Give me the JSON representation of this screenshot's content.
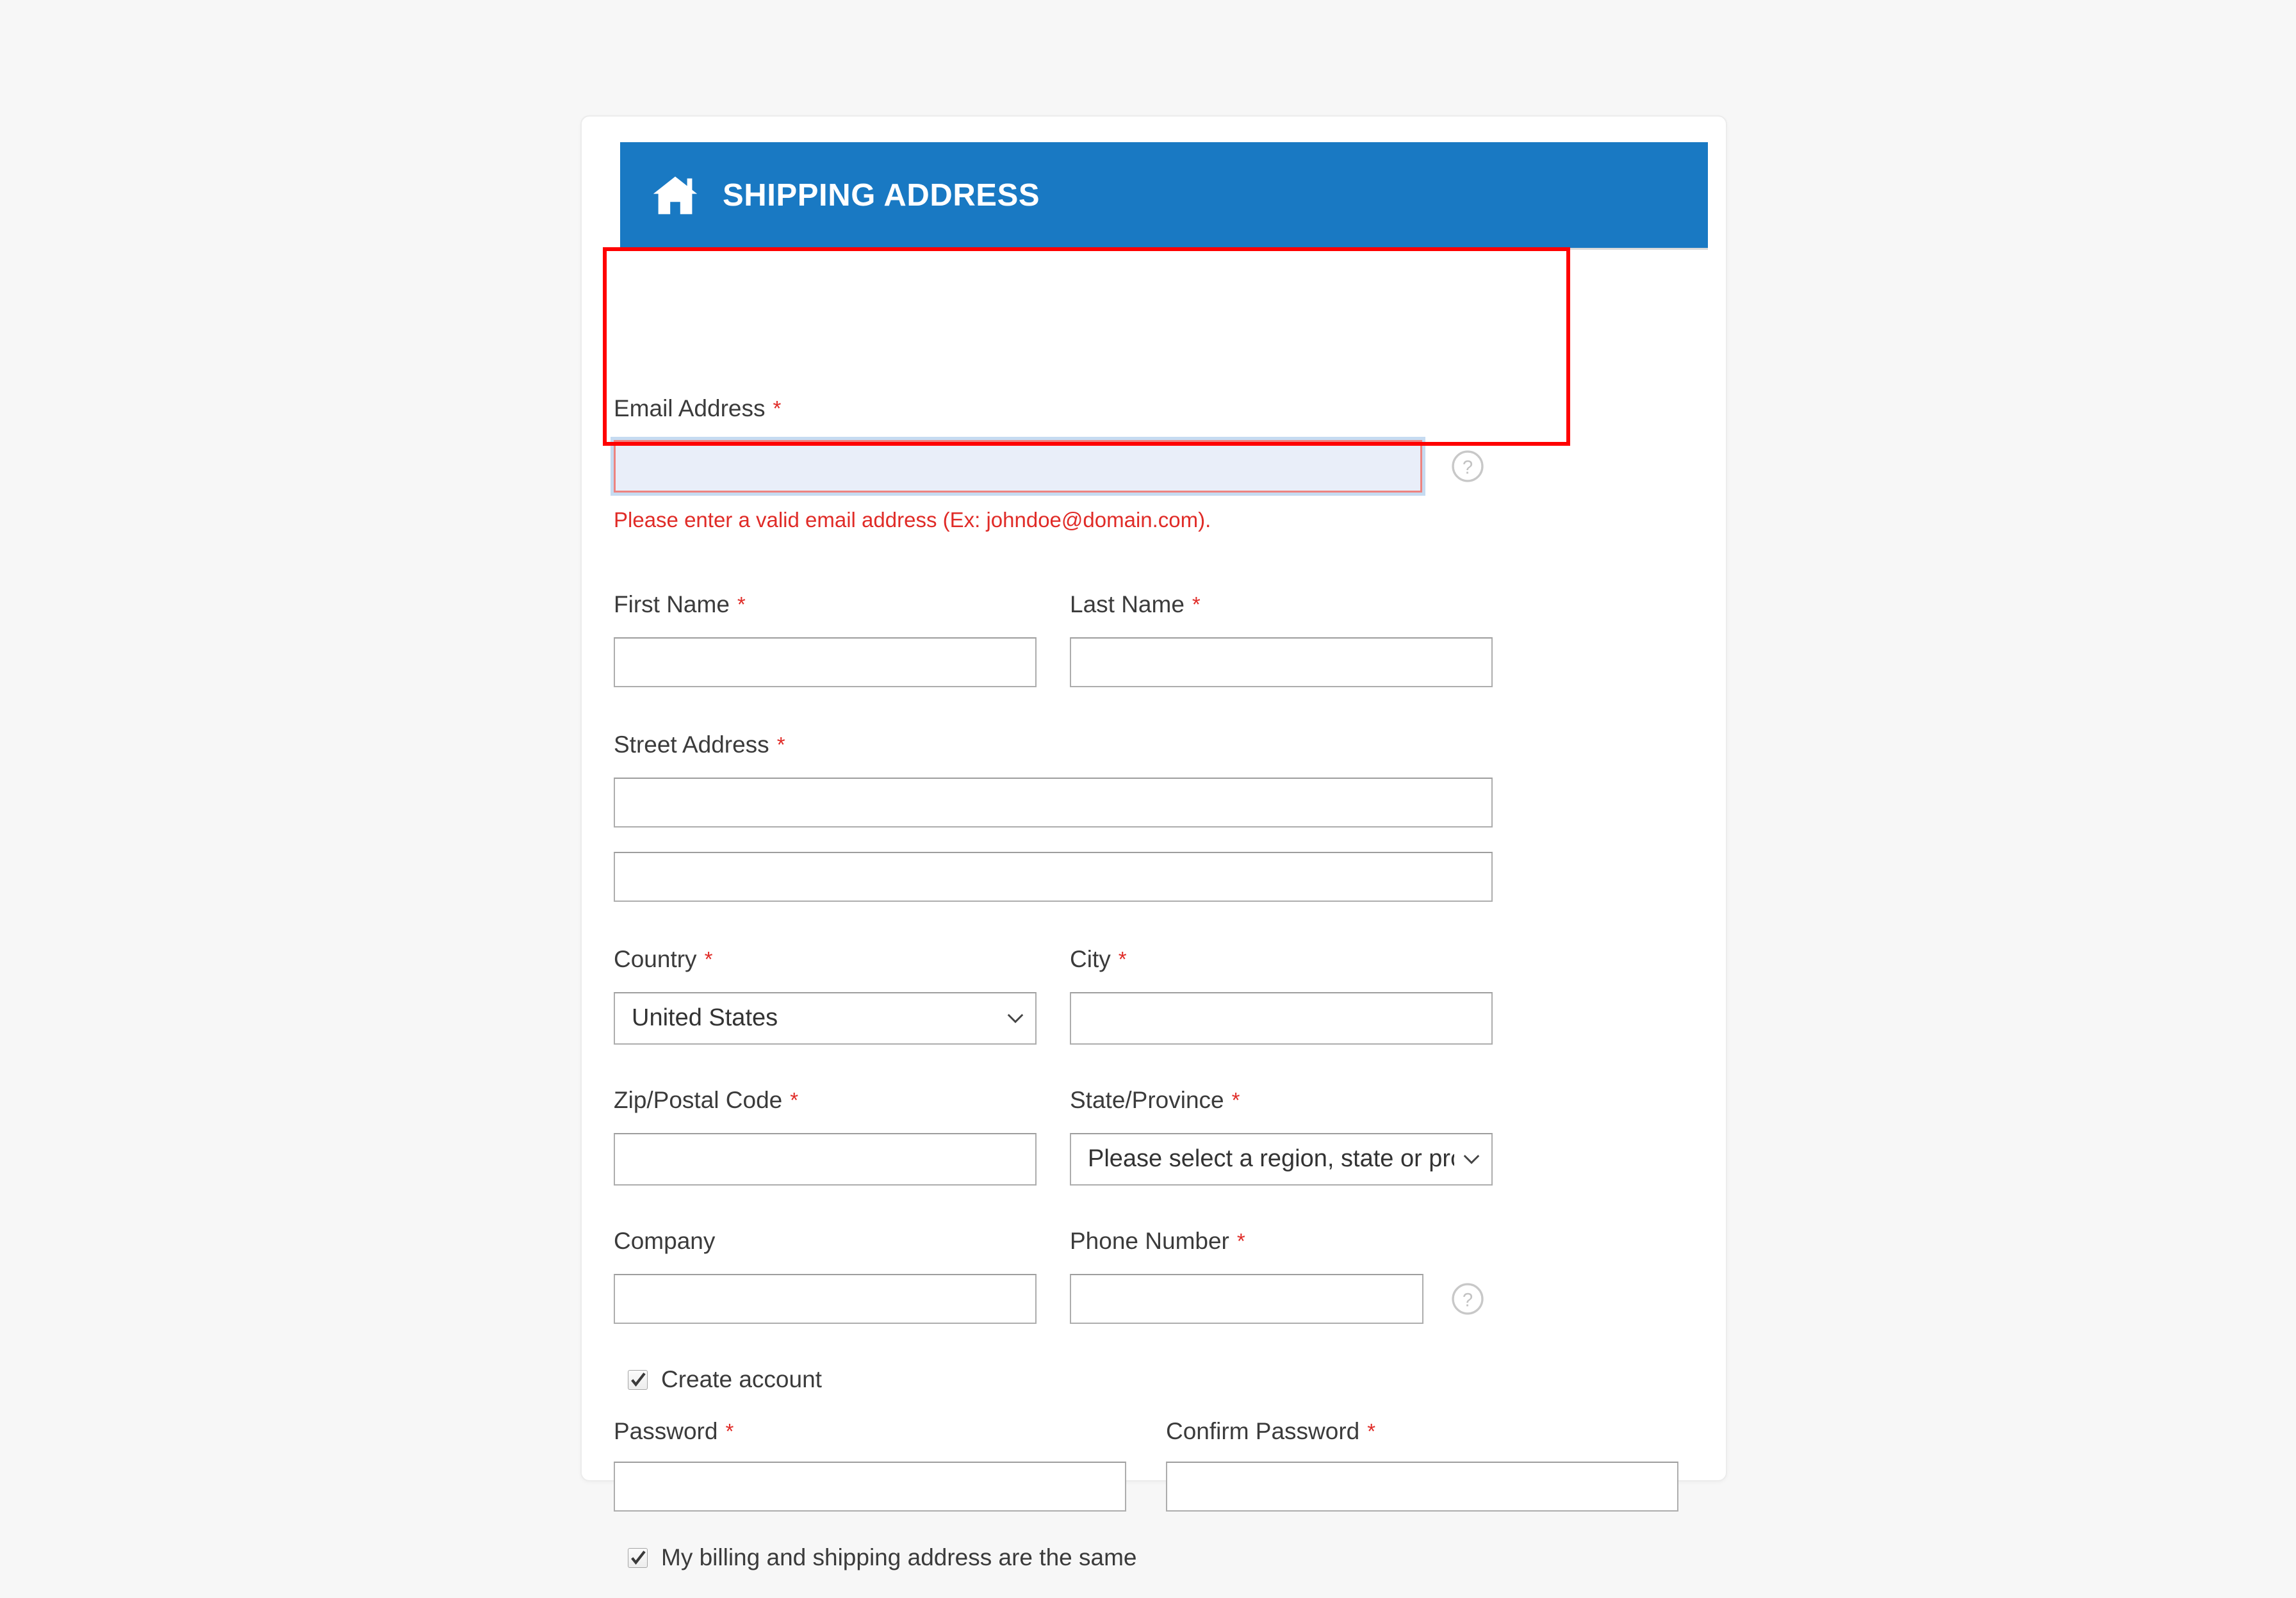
{
  "panel": {
    "icon": "home-icon",
    "title": "SHIPPING ADDRESS",
    "accent_color": "#1979c3",
    "required_marker": "*",
    "error_color": "#e02b27",
    "annotation_color": "#ff0000"
  },
  "fields": {
    "email": {
      "label": "Email Address",
      "required": "*",
      "value": "",
      "placeholder": "",
      "error": "Please enter a valid email address (Ex: johndoe@domain.com).",
      "help_icon": "question-mark-circle-icon"
    },
    "first_name": {
      "label": "First Name",
      "required": "*",
      "value": "",
      "placeholder": ""
    },
    "last_name": {
      "label": "Last Name",
      "required": "*",
      "value": "",
      "placeholder": ""
    },
    "street": {
      "label": "Street Address",
      "required": "*",
      "line1": "",
      "line2": "",
      "placeholder": ""
    },
    "country": {
      "label": "Country",
      "required": "*",
      "value": "United States",
      "icon": "chevron-down-icon"
    },
    "city": {
      "label": "City",
      "required": "*",
      "value": "",
      "placeholder": ""
    },
    "zip": {
      "label": "Zip/Postal Code",
      "required": "*",
      "value": "",
      "placeholder": ""
    },
    "state": {
      "label": "State/Province",
      "required": "*",
      "value": "Please select a region, state or province.",
      "icon": "chevron-down-icon"
    },
    "company": {
      "label": "Company",
      "required": "",
      "value": "",
      "placeholder": ""
    },
    "phone": {
      "label": "Phone Number",
      "required": "*",
      "value": "",
      "placeholder": "",
      "help_icon": "question-mark-circle-icon"
    },
    "password": {
      "label": "Password",
      "required": "*",
      "value": "",
      "placeholder": ""
    },
    "confirm_password": {
      "label": "Confirm Password",
      "required": "*",
      "value": "",
      "placeholder": ""
    }
  },
  "checkboxes": {
    "create_account": {
      "label": "Create account",
      "checked": "true"
    },
    "billing_same": {
      "label": "My billing and shipping address are the same",
      "checked": "true"
    }
  }
}
